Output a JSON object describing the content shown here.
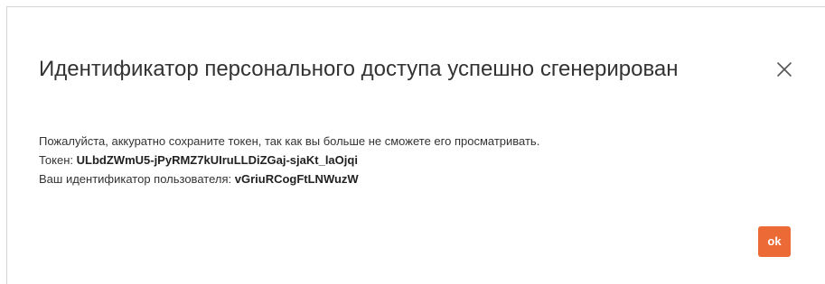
{
  "dialog": {
    "title": "Идентификатор персонального доступа успешно сгенерирован",
    "close_icon": "close-icon",
    "message": "Пожалуйста, аккуратно сохраните токен, так как вы больше не сможете его просматривать.",
    "token_label": "Токен:",
    "token_value": "ULbdZWmU5-jPyRMZ7kUIruLLDiZGaj-sjaKt_laOjqi",
    "user_id_label": "Ваш идентификатор пользователя:",
    "user_id_value": "vGriuRCogFtLNWuzW",
    "ok_label": "ok"
  },
  "colors": {
    "accent": "#ec6a35",
    "text": "#333333",
    "border": "#d4d4d4",
    "close_icon": "#555555"
  }
}
